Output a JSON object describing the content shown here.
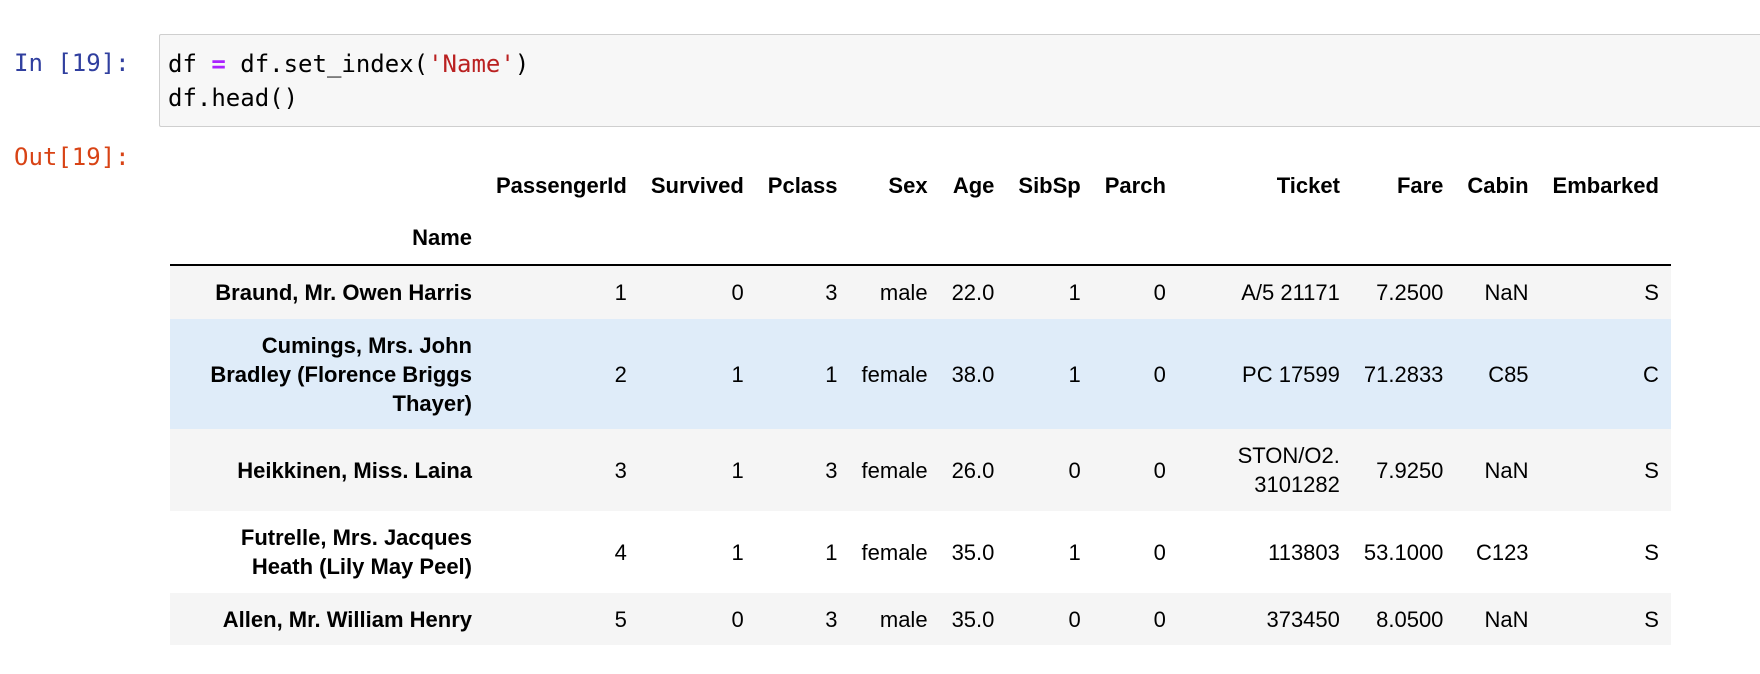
{
  "cell": {
    "in_prompt": "In [19]:",
    "out_prompt": "Out[19]:",
    "code_line1": {
      "a": "df ",
      "op": "=",
      "b": " df.set_index(",
      "str": "'Name'",
      "c": ")"
    },
    "code_line2": "df.head()"
  },
  "table": {
    "index_name": "Name",
    "columns": [
      "PassengerId",
      "Survived",
      "Pclass",
      "Sex",
      "Age",
      "SibSp",
      "Parch",
      "Ticket",
      "Fare",
      "Cabin",
      "Embarked"
    ],
    "rows": [
      {
        "name": "Braund, Mr. Owen Harris",
        "cells": [
          "1",
          "0",
          "3",
          "male",
          "22.0",
          "1",
          "0",
          "A/5 21171",
          "7.2500",
          "NaN",
          "S"
        ]
      },
      {
        "name": "Cumings, Mrs. John Bradley (Florence Briggs Thayer)",
        "cells": [
          "2",
          "1",
          "1",
          "female",
          "38.0",
          "1",
          "0",
          "PC 17599",
          "71.2833",
          "C85",
          "C"
        ]
      },
      {
        "name": "Heikkinen, Miss. Laina",
        "cells": [
          "3",
          "1",
          "3",
          "female",
          "26.0",
          "0",
          "0",
          "STON/O2. 3101282",
          "7.9250",
          "NaN",
          "S"
        ]
      },
      {
        "name": "Futrelle, Mrs. Jacques Heath (Lily May Peel)",
        "cells": [
          "4",
          "1",
          "1",
          "female",
          "35.0",
          "1",
          "0",
          "113803",
          "53.1000",
          "C123",
          "S"
        ]
      },
      {
        "name": "Allen, Mr. William Henry",
        "cells": [
          "5",
          "0",
          "3",
          "male",
          "35.0",
          "0",
          "0",
          "373450",
          "8.0500",
          "NaN",
          "S"
        ]
      }
    ]
  }
}
